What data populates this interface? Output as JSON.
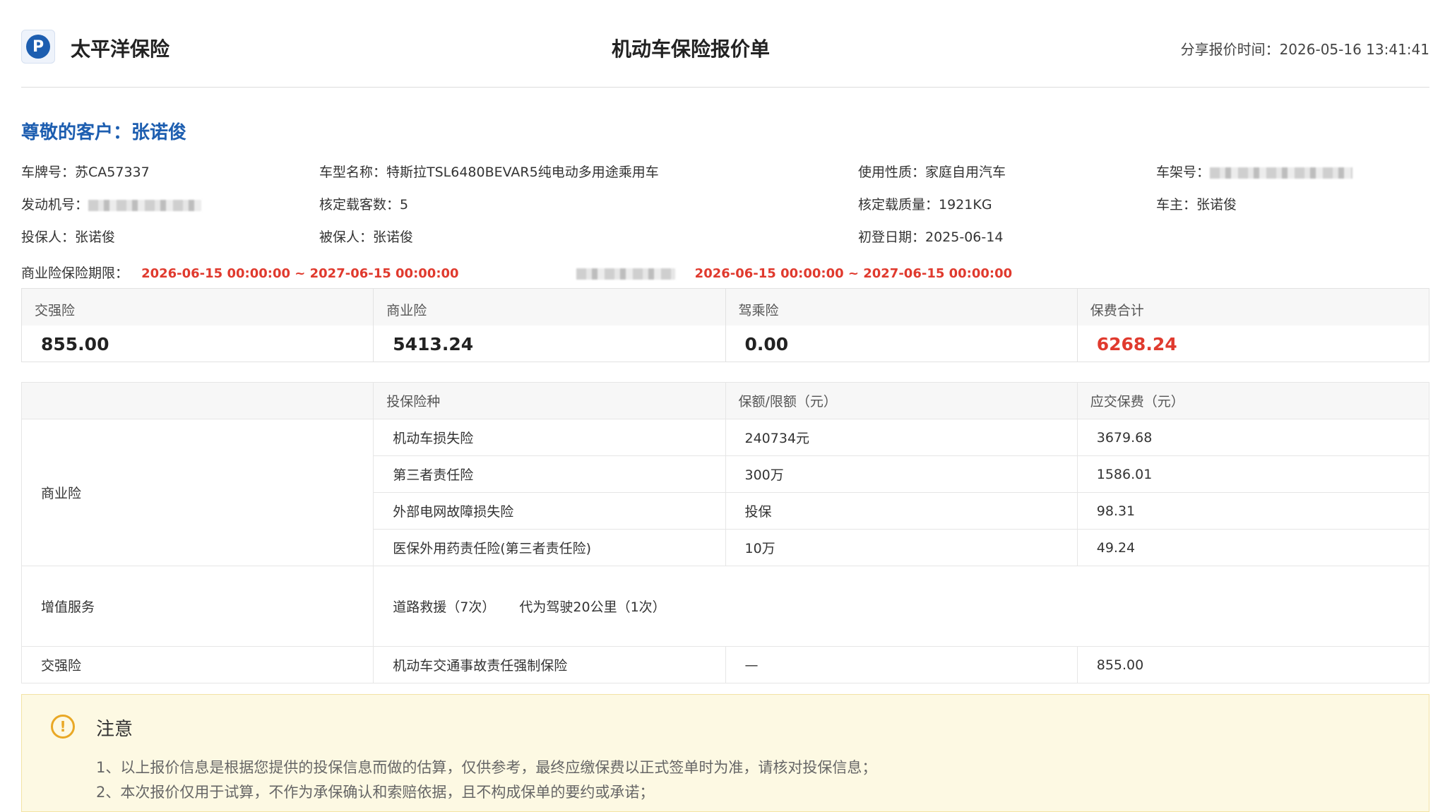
{
  "header": {
    "company": "太平洋保险",
    "title": "机动车保险报价单",
    "share_time_label": "分享报价时间：",
    "share_time": "2026-05-16 13:41:41"
  },
  "greeting": "尊敬的客户：张诺俊",
  "vehicle_info": {
    "plate": "车牌号：苏CA57337",
    "model": "车型名称：特斯拉TSL6480BEVAR5纯电动多用途乘用车",
    "usage": "使用性质：家庭自用汽车",
    "vin_label": "车架号：",
    "engine_label": "发动机号：",
    "seats": "核定载客数：5",
    "mass": "核定载质量：1921KG",
    "owner": "车主：张诺俊",
    "applicant": "投保人：张诺俊",
    "insured": "被保人：张诺俊",
    "register_date": "初登日期：2025-06-14"
  },
  "periods": {
    "commercial_label": "商业险保险期限：",
    "commercial_range": "2026-06-15 00:00:00 ~ 2027-06-15 00:00:00",
    "compulsory_range": "2026-06-15 00:00:00 ~ 2027-06-15 00:00:00"
  },
  "summary": [
    {
      "label": "交强险",
      "value": "855.00"
    },
    {
      "label": "商业险",
      "value": "5413.24"
    },
    {
      "label": "驾乘险",
      "value": "0.00"
    },
    {
      "label": "保费合计",
      "value": "6268.24"
    }
  ],
  "detail": {
    "headers": [
      "",
      "投保险种",
      "保额/限额（元）",
      "应交保费（元）"
    ],
    "commercial_group": "商业险",
    "commercial_rows": [
      {
        "name": "机动车损失险",
        "amount": "240734元",
        "premium": "3679.68"
      },
      {
        "name": "第三者责任险",
        "amount": "300万",
        "premium": "1586.01"
      },
      {
        "name": "外部电网故障损失险",
        "amount": "投保",
        "premium": "98.31"
      },
      {
        "name": "医保外用药责任险(第三者责任险)",
        "amount": "10万",
        "premium": "49.24"
      }
    ],
    "service_group": "增值服务",
    "services": [
      "道路救援（7次）",
      "代为驾驶20公里（1次）"
    ],
    "compulsory_group": "交强险",
    "compulsory_row": {
      "name": "机动车交通事故责任强制保险",
      "amount": "—",
      "premium": "855.00"
    }
  },
  "notice": {
    "title": "注意",
    "lines": [
      "1、以上报价信息是根据您提供的投保信息而做的估算，仅供参考，最终应缴保费以正式签单时为准，请核对投保信息；",
      "2、本次报价仅用于试算，不作为承保确认和索赔依据，且不构成保单的要约或承诺；"
    ]
  }
}
